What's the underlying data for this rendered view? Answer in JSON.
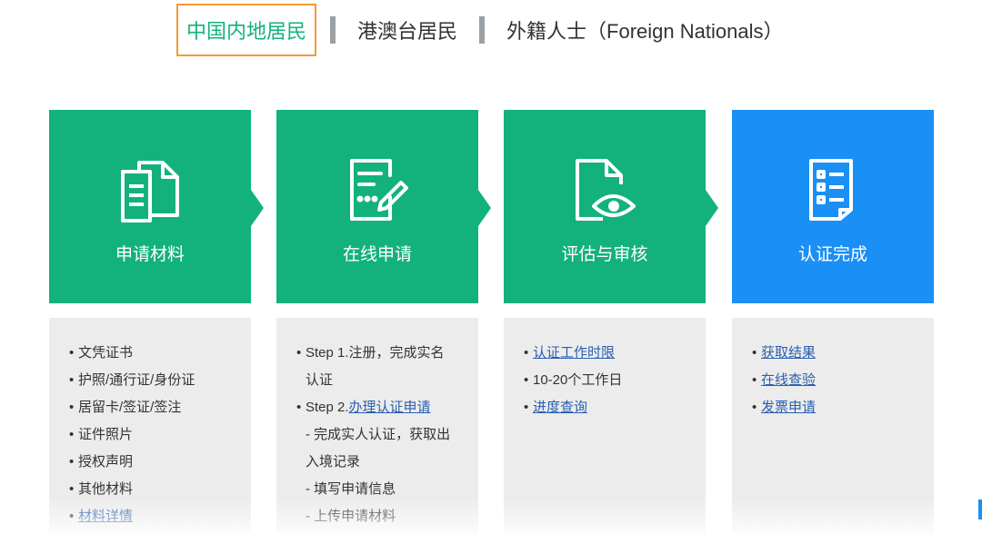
{
  "tabs": {
    "mainland": "中国内地居民",
    "hmt": "港澳台居民",
    "foreign": "外籍人士（Foreign Nationals）"
  },
  "steps": [
    {
      "label": "申请材料",
      "icon": "documents-icon",
      "color": "#13b27d"
    },
    {
      "label": "在线申请",
      "icon": "form-edit-icon",
      "color": "#13b27d"
    },
    {
      "label": "评估与审核",
      "icon": "document-eye-icon",
      "color": "#13b27d"
    },
    {
      "label": "认证完成",
      "icon": "checklist-icon",
      "color": "#1a8ff5"
    }
  ],
  "panels": {
    "materials": {
      "items": [
        "文凭证书",
        "护照/通行证/身份证",
        "居留卡/签证/签注",
        "证件照片",
        "授权声明",
        "其他材料"
      ],
      "link": "材料详情"
    },
    "online": {
      "step1": "Step 1.注册，完成实名",
      "step1_cont": "认证",
      "step2_prefix": "Step 2.",
      "step2_link": "办理认证申请",
      "sub1": "- 完成实人认证，获取出",
      "sub1_cont": "入境记录",
      "sub2": "- 填写申请信息",
      "sub3": "- 上传申请材料"
    },
    "review": {
      "link1": "认证工作时限",
      "text": "10-20个工作日",
      "link2": "进度查询"
    },
    "complete": {
      "link1": "获取结果",
      "link2": "在线查验",
      "link3": "发票申请"
    }
  },
  "colors": {
    "green": "#13b27d",
    "blue": "#1a8ff5",
    "orange": "#f39a34",
    "link": "#2a5fb0"
  }
}
